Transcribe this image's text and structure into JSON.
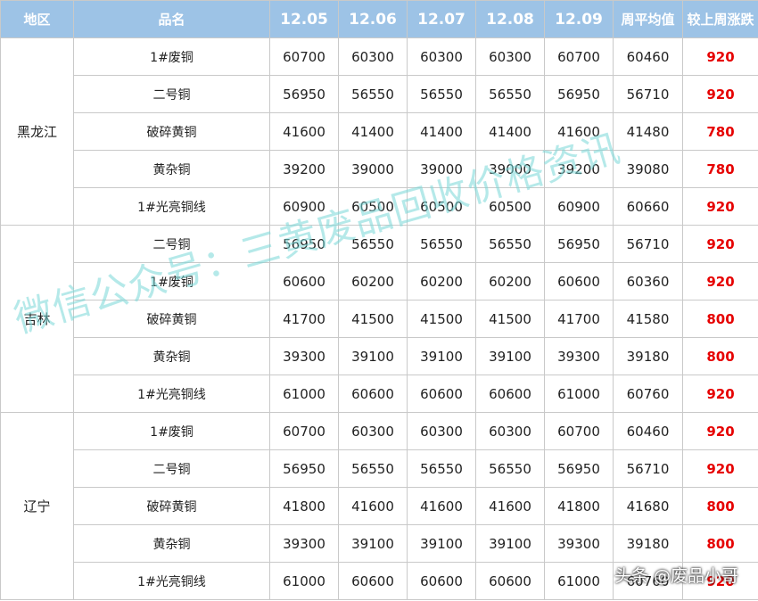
{
  "header": {
    "region": "地区",
    "name": "品名",
    "dates": [
      "12.05",
      "12.06",
      "12.07",
      "12.08",
      "12.09"
    ],
    "avg": "周平均值",
    "change": "较上周涨跌"
  },
  "regions": [
    {
      "name": "黑龙江",
      "rows": [
        {
          "name": "1#废铜",
          "prices": [
            "60700",
            "60300",
            "60300",
            "60300",
            "60700"
          ],
          "avg": "60460",
          "change": "920"
        },
        {
          "name": "二号铜",
          "prices": [
            "56950",
            "56550",
            "56550",
            "56550",
            "56950"
          ],
          "avg": "56710",
          "change": "920"
        },
        {
          "name": "破碎黄铜",
          "prices": [
            "41600",
            "41400",
            "41400",
            "41400",
            "41600"
          ],
          "avg": "41480",
          "change": "780"
        },
        {
          "name": "黄杂铜",
          "prices": [
            "39200",
            "39000",
            "39000",
            "39000",
            "39200"
          ],
          "avg": "39080",
          "change": "780"
        },
        {
          "name": "1#光亮铜线",
          "prices": [
            "60900",
            "60500",
            "60500",
            "60500",
            "60900"
          ],
          "avg": "60660",
          "change": "920"
        }
      ]
    },
    {
      "name": "吉林",
      "rows": [
        {
          "name": "二号铜",
          "prices": [
            "56950",
            "56550",
            "56550",
            "56550",
            "56950"
          ],
          "avg": "56710",
          "change": "920"
        },
        {
          "name": "1#废铜",
          "prices": [
            "60600",
            "60200",
            "60200",
            "60200",
            "60600"
          ],
          "avg": "60360",
          "change": "920"
        },
        {
          "name": "破碎黄铜",
          "prices": [
            "41700",
            "41500",
            "41500",
            "41500",
            "41700"
          ],
          "avg": "41580",
          "change": "800"
        },
        {
          "name": "黄杂铜",
          "prices": [
            "39300",
            "39100",
            "39100",
            "39100",
            "39300"
          ],
          "avg": "39180",
          "change": "800"
        },
        {
          "name": "1#光亮铜线",
          "prices": [
            "61000",
            "60600",
            "60600",
            "60600",
            "61000"
          ],
          "avg": "60760",
          "change": "920"
        }
      ]
    },
    {
      "name": "辽宁",
      "rows": [
        {
          "name": "1#废铜",
          "prices": [
            "60700",
            "60300",
            "60300",
            "60300",
            "60700"
          ],
          "avg": "60460",
          "change": "920"
        },
        {
          "name": "二号铜",
          "prices": [
            "56950",
            "56550",
            "56550",
            "56550",
            "56950"
          ],
          "avg": "56710",
          "change": "920"
        },
        {
          "name": "破碎黄铜",
          "prices": [
            "41800",
            "41600",
            "41600",
            "41600",
            "41800"
          ],
          "avg": "41680",
          "change": "800"
        },
        {
          "name": "黄杂铜",
          "prices": [
            "39300",
            "39100",
            "39100",
            "39100",
            "39300"
          ],
          "avg": "39180",
          "change": "800"
        },
        {
          "name": "1#光亮铜线",
          "prices": [
            "61000",
            "60600",
            "60600",
            "60600",
            "61000"
          ],
          "avg": "60760",
          "change": "920"
        }
      ]
    }
  ],
  "watermark": "微信公众号：三黄废品回收价格资讯",
  "credit": "头条 @废品小哥",
  "colors": {
    "header_bg": "#9dc3e6",
    "change_text": "#e60000",
    "watermark": "#78d7d7"
  }
}
